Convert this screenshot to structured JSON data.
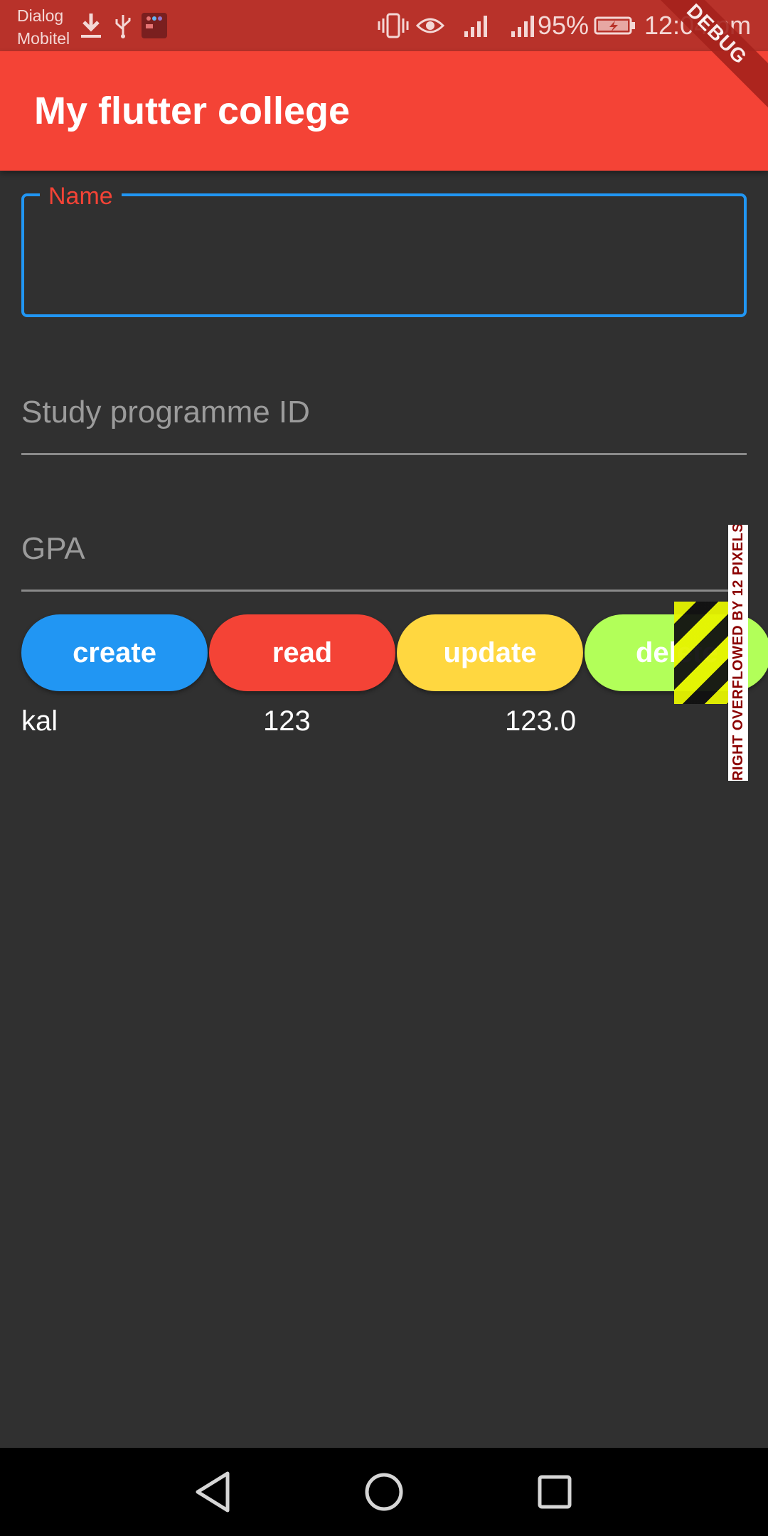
{
  "status_bar": {
    "carrier_line1": "Dialog",
    "carrier_line2": "Mobitel",
    "battery_percent": "95%",
    "time": "12:04 pm",
    "icons": [
      "download-icon",
      "usb-icon",
      "app-notification-icon",
      "vibrate-icon",
      "eye-icon",
      "signal-icon",
      "signal-icon",
      "battery-charging-icon"
    ]
  },
  "app_bar": {
    "title": "My flutter college",
    "debug_banner": "DEBUG"
  },
  "form": {
    "name_label": "Name",
    "name_value": "",
    "study_programme_placeholder": "Study programme ID",
    "gpa_placeholder": "GPA"
  },
  "buttons": {
    "create": "create",
    "read": "read",
    "update": "update",
    "delete": "delete"
  },
  "overflow_warning": "RIGHT OVERFLOWED BY 12 PIXELS",
  "record": {
    "name": "kal",
    "programme_id": "123",
    "gpa": "123.0"
  },
  "nav_bar": {
    "icons": [
      "back-icon",
      "home-icon",
      "recents-icon"
    ]
  },
  "colors": {
    "app_bar": "#f44336",
    "status_bar": "#b8322a",
    "background": "#303030",
    "focus": "#2196f3",
    "create": "#2196f3",
    "read": "#f44336",
    "update": "#ffd740",
    "delete": "#b2ff59"
  }
}
